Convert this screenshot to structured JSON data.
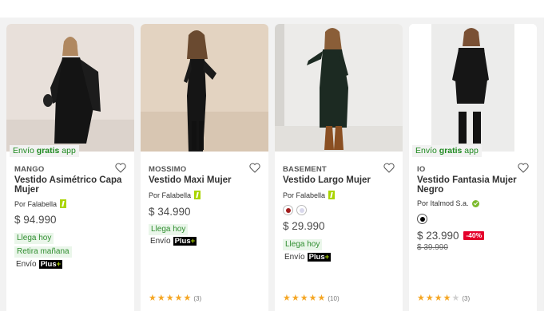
{
  "products": [
    {
      "ribbon_prefix": "Envío ",
      "ribbon_bold": "gratis",
      "ribbon_suffix": " app",
      "brand": "MANGO",
      "title": "Vestido Asimétrico Capa Mujer",
      "seller": "Por Falabella",
      "seller_badge": "falabella-badge-icon",
      "price": "$ 94.990",
      "tags": [
        "Llega hoy",
        "Retira mañana"
      ],
      "envio_label": "Envío",
      "plus_label": "Plus",
      "plus_symbol": "+"
    },
    {
      "brand": "MOSSIMO",
      "title": "Vestido Maxi Mujer",
      "seller": "Por Falabella",
      "seller_badge": "falabella-badge-icon",
      "price": "$ 34.990",
      "tags": [
        "Llega hoy"
      ],
      "envio_label": "Envío",
      "plus_label": "Plus",
      "plus_symbol": "+",
      "rating_stars": 5,
      "rating_count": "(3)"
    },
    {
      "brand": "BASEMENT",
      "title": "Vestido Largo Mujer",
      "seller": "Por Falabella",
      "seller_badge": "falabella-badge-icon",
      "swatch_colors": [
        "#a21c1c",
        "#d9d8ec"
      ],
      "price": "$ 29.990",
      "tags": [
        "Llega hoy"
      ],
      "envio_label": "Envío",
      "plus_label": "Plus",
      "plus_symbol": "+",
      "rating_stars": 5,
      "rating_count": "(10)"
    },
    {
      "ribbon_prefix": "Envío ",
      "ribbon_bold": "gratis",
      "ribbon_suffix": " app",
      "brand": "IO",
      "title": "Vestido Fantasia Mujer Negro",
      "seller": "Por Italmod S.a.",
      "seller_badge": "verified-seller-icon",
      "swatch_colors": [
        "#000000"
      ],
      "price": "$ 23.990",
      "discount": "-40%",
      "old_price": "$ 39.990",
      "rating_stars": 4,
      "rating_count": "(3)"
    }
  ],
  "colors": {
    "ribbon_text": "#1f8a20",
    "tag_bg": "#eaf6ea",
    "tag_text": "#2f8d2f",
    "discount_bg": "#e4002b",
    "star": "#f5a623",
    "falabella_green": "#aad500"
  },
  "icons": {
    "favorite": "heart-outline-icon",
    "star": "star-icon"
  }
}
